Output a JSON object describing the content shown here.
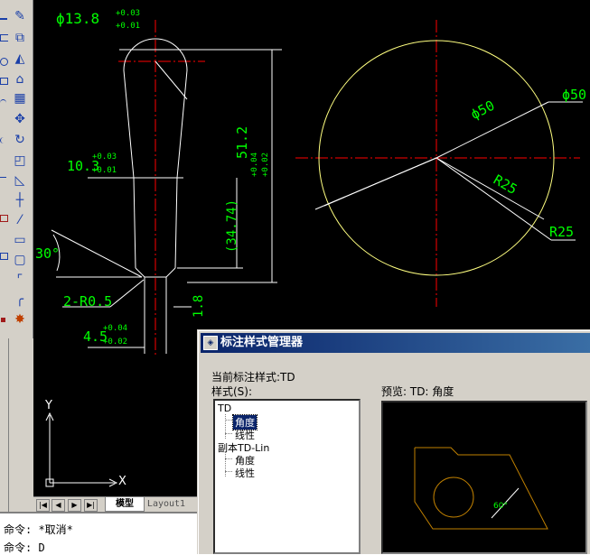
{
  "drawing": {
    "dims": {
      "d_top": "ϕ13.8",
      "d_top_tol_hi": "+0.03",
      "d_top_tol_lo": "+0.01",
      "d_mid": "10.3",
      "d_mid_tol_hi": "+0.03",
      "d_mid_tol_lo": "+0.01",
      "d_bot": "4.5",
      "d_bot_tol_hi": "+0.04",
      "d_bot_tol_lo": "+0.02",
      "len_total": "51.2",
      "len_total_tol_hi": "+0.04",
      "len_total_tol_lo": "+0.02",
      "len_ref": "(34.74)",
      "len_tip": "1.8",
      "angle": "30°",
      "fillet": "2-R0.5",
      "circle_d1": "ϕ50",
      "circle_d2": "ϕ50",
      "circle_r1": "R25",
      "circle_r2": "R25"
    },
    "ucs": {
      "x_label": "X",
      "y_label": "Y"
    }
  },
  "layout_tabs": {
    "model": "模型",
    "layout1": "Layout1"
  },
  "command_line": {
    "line1": "命令: *取消*",
    "line2": "命令: D"
  },
  "dialog": {
    "title": "标注样式管理器",
    "current_style": "当前标注样式:TD",
    "styles_label": "样式(S):",
    "preview_label": "预览: TD: 角度",
    "styles": {
      "item1": "TD",
      "item2": "角度",
      "item3": "线性",
      "item4": "副本TD-Lin",
      "item5": "角度",
      "item6": "线性"
    },
    "preview_angle": "60°"
  },
  "colors": {
    "canvas": "#000000",
    "geometry": "#ffffff",
    "center_line": "#ff0000",
    "dimension": "#00ff00",
    "circle": "#ffff80",
    "preview_geometry": "#c08000"
  }
}
